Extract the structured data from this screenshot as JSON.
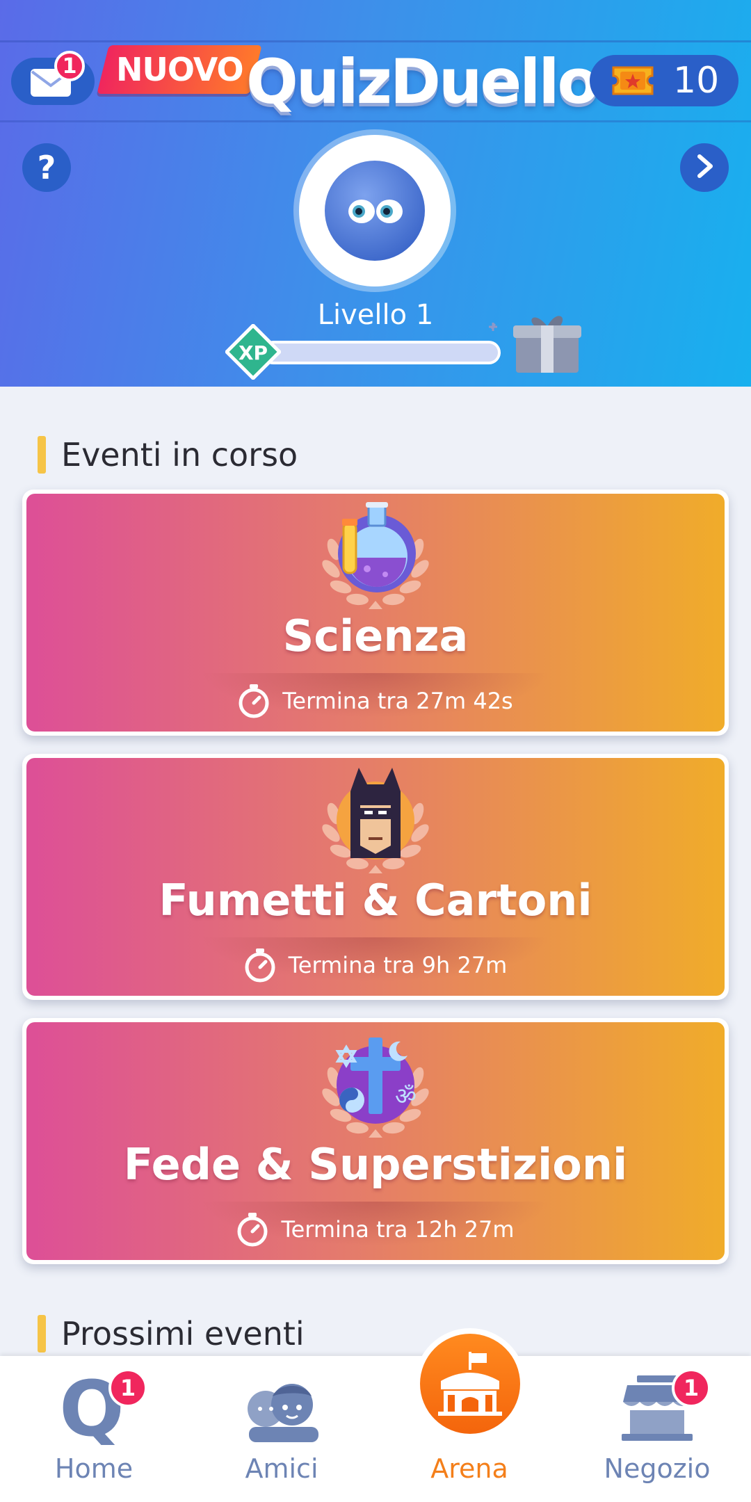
{
  "header": {
    "mail_badge": "1",
    "new_tag": "NUOVO",
    "app_title": "QuizDuello",
    "tickets_count": "10",
    "help_label": "?",
    "level_label": "Livello 1",
    "xp_label": "XP",
    "xp_progress": 0.0
  },
  "sections": {
    "current_events_title": "Eventi in corso",
    "upcoming_events_title": "Prossimi eventi"
  },
  "events": [
    {
      "title": "Scienza",
      "timer": "Termina tra 27m 42s",
      "icon": "science-flask-icon"
    },
    {
      "title": "Fumetti & Cartoni",
      "timer": "Termina tra 9h 27m",
      "icon": "comics-hero-icon"
    },
    {
      "title": "Fede & Superstizioni",
      "timer": "Termina tra 12h 27m",
      "icon": "religion-symbols-icon"
    }
  ],
  "nav": {
    "home": {
      "label": "Home",
      "badge": "1"
    },
    "friends": {
      "label": "Amici"
    },
    "arena": {
      "label": "Arena"
    },
    "shop": {
      "label": "Negozio",
      "badge": "1"
    }
  },
  "colors": {
    "header_start": "#5a6be8",
    "header_end": "#18b0ee",
    "card_start": "#dd4f97",
    "card_end": "#f0ac2a",
    "badge": "#f0265d",
    "nav_active": "#f47f1a",
    "nav_inactive": "#6d84b4"
  }
}
